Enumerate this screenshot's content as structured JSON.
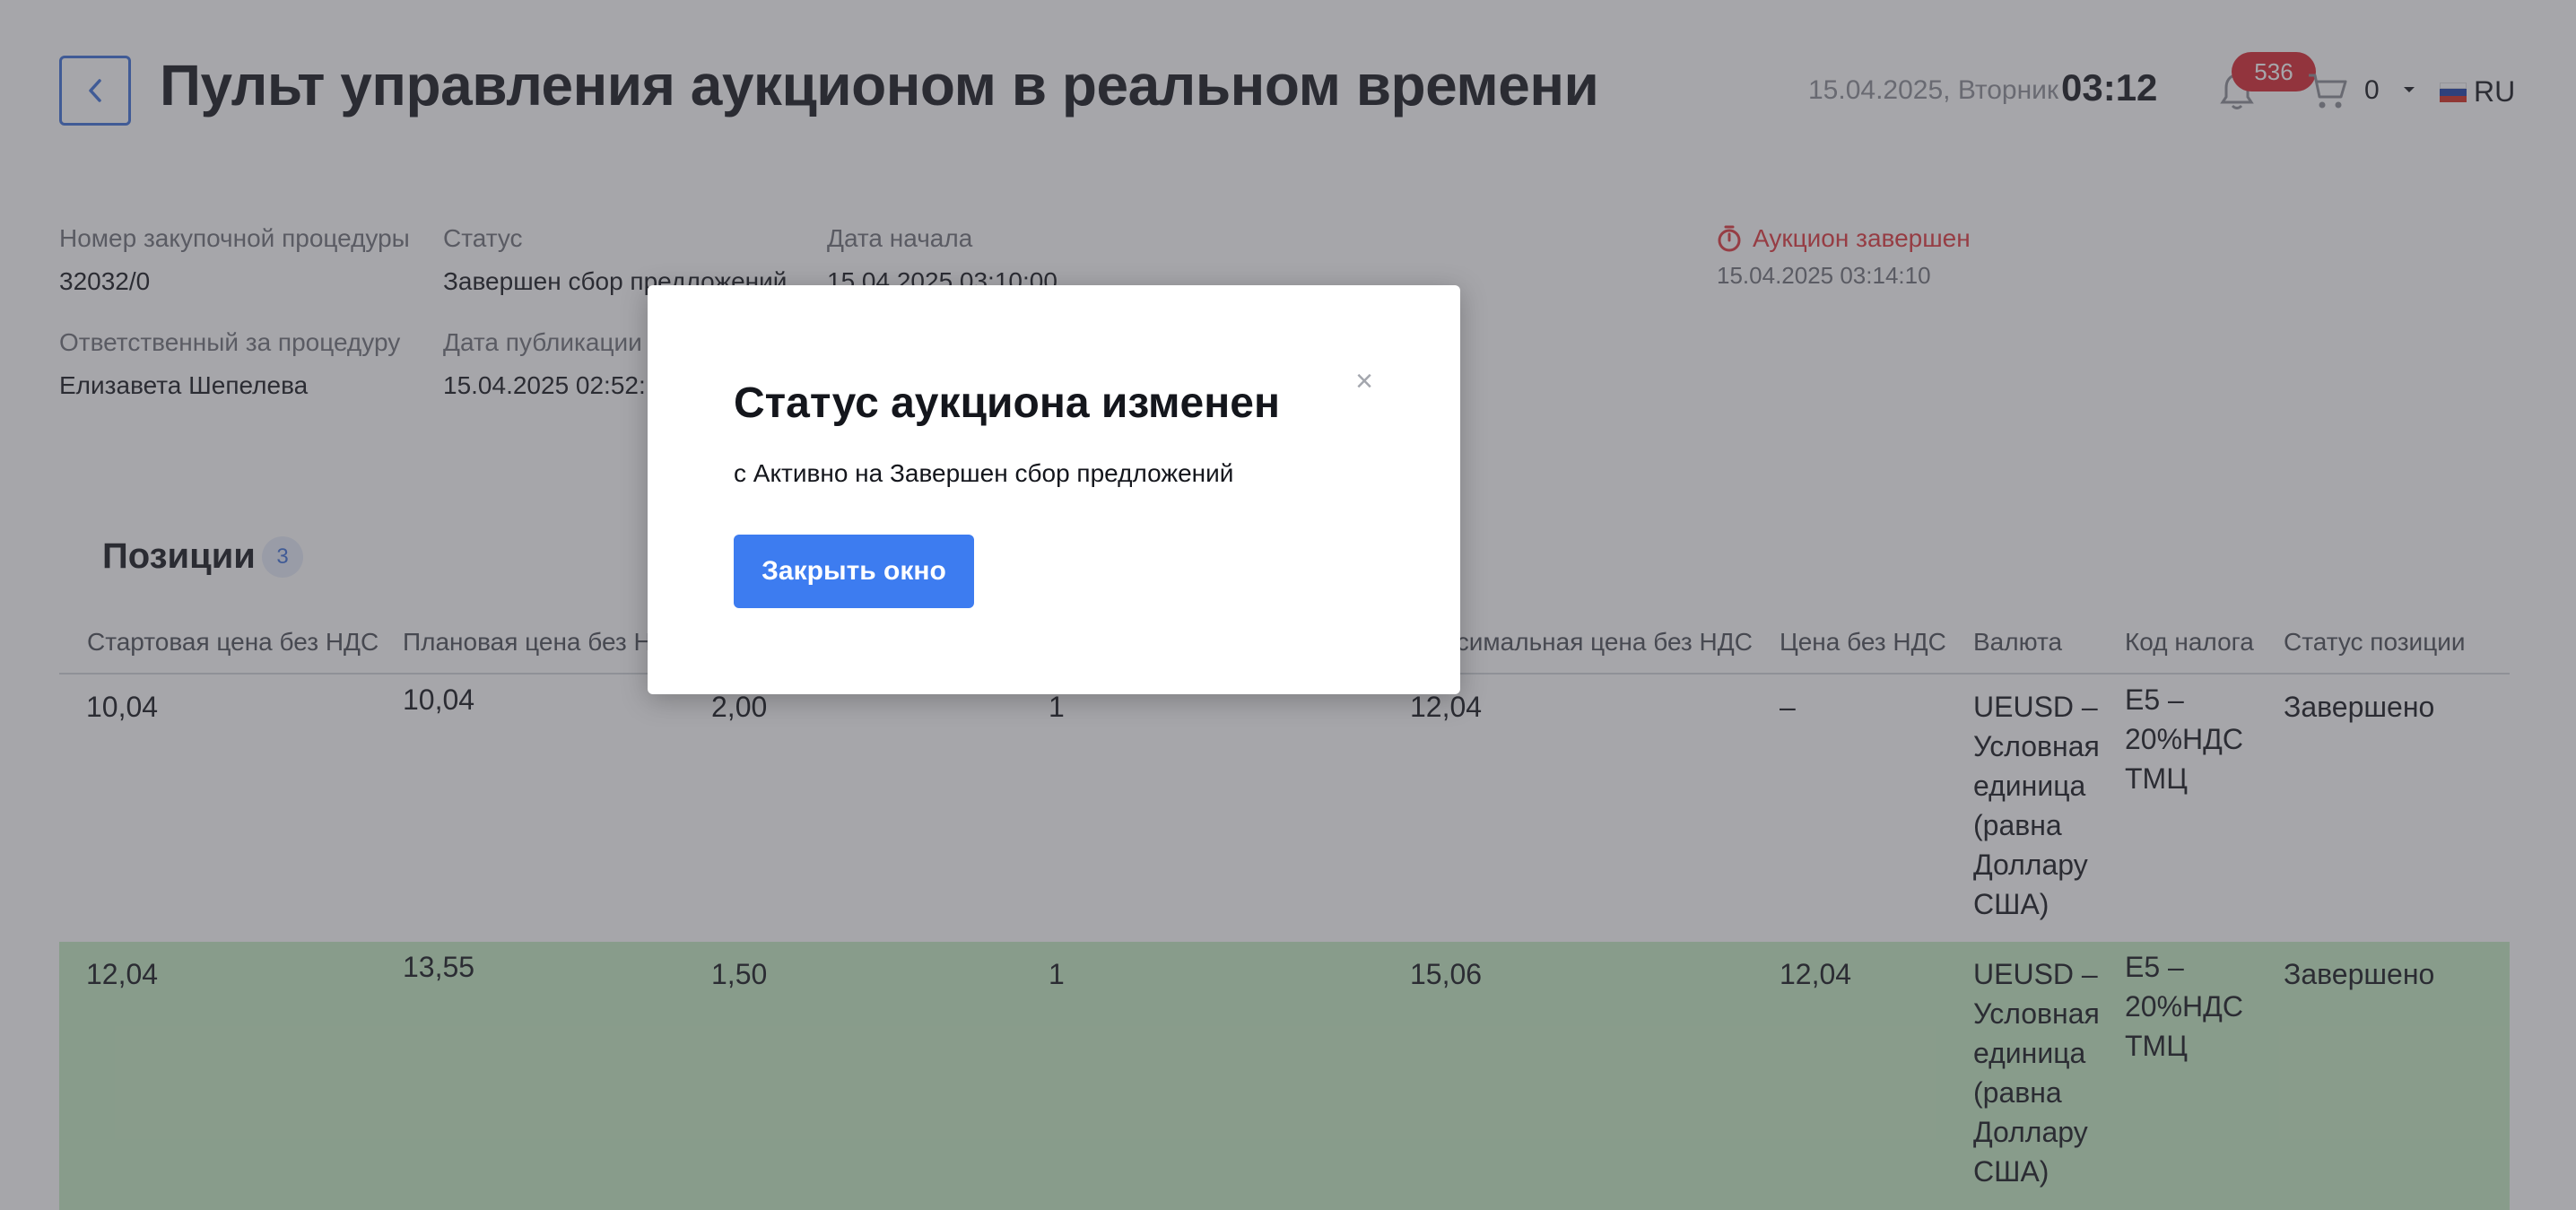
{
  "header": {
    "title": "Пульт управления аукционом в реальном времени",
    "date": "15.04.2025, Вторник",
    "time": "03:12",
    "notifications_count": "536",
    "cart_count": "0",
    "language": "RU",
    "back_icon": "chevron-left-icon"
  },
  "info": {
    "procedure_number_label": "Номер закупочной процедуры",
    "procedure_number": "32032/0",
    "status_label": "Статус",
    "status": "Завершен сбор предложений",
    "start_date_label": "Дата начала",
    "start_date": "15.04.2025 03:10:00",
    "responsible_label": "Ответственный за процедуру",
    "responsible": "Елизавета Шепелева",
    "publish_date_label": "Дата публикации",
    "publish_date": "15.04.2025 02:52:",
    "auction_end_label": "Аукцион завершен",
    "auction_end_date": "15.04.2025 03:14:10"
  },
  "positions": {
    "title": "Позиции",
    "count": "3",
    "headers": [
      "Стартовая цена без НДС",
      "Плановая цена без НДС",
      "",
      "",
      "Максимальная цена без НДС",
      "Цена без НДС",
      "Валюта",
      "Код налога",
      "Статус позиции"
    ],
    "rows": [
      {
        "start_price": "10,04",
        "plan_price": "10,04",
        "step": "2,00",
        "qty": "1",
        "max_price": "12,04",
        "price": "–",
        "currency": [
          "UEUSD –",
          "Условная",
          "единица",
          "(равна",
          "Доллару",
          "США)"
        ],
        "tax": [
          "E5 –",
          "20%НДС",
          "ТМЦ"
        ],
        "status": "Завершено"
      },
      {
        "start_price": "12,04",
        "plan_price": "13,55",
        "step": "1,50",
        "qty": "1",
        "max_price": "15,06",
        "price": "12,04",
        "currency": [
          "UEUSD –",
          "Условная",
          "единица",
          "(равна",
          "Доллару",
          "США)"
        ],
        "tax": [
          "E5 –",
          "20%НДС",
          "ТМЦ"
        ],
        "status": "Завершено"
      }
    ]
  },
  "modal": {
    "title": "Статус аукциона изменен",
    "text": "с Активно на Завершен сбор предложений",
    "button": "Закрыть окно",
    "close_symbol": "×"
  },
  "colors": {
    "accent": "#3d7cf0",
    "badge_red": "#d8262f",
    "ended_red": "#e0373d",
    "row_highlight": "#c6ebc3"
  }
}
